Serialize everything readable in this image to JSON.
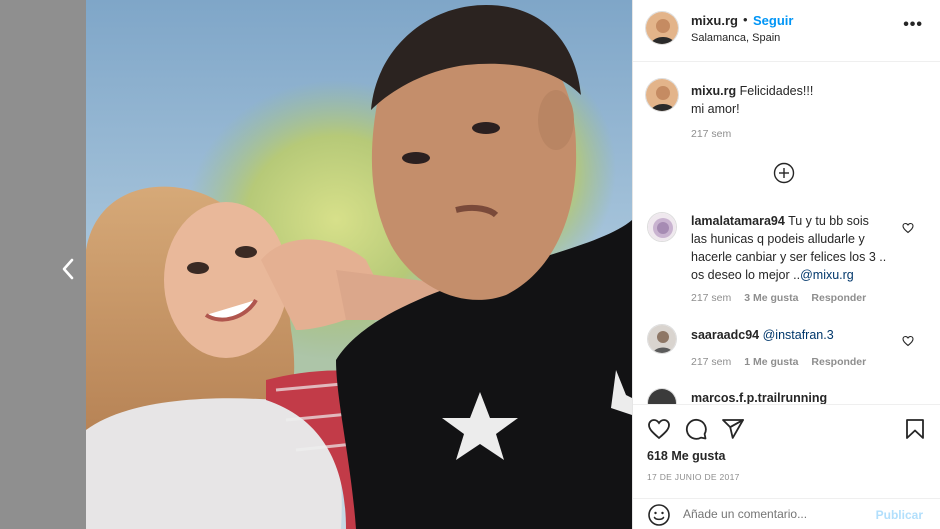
{
  "post": {
    "username": "mixu.rg",
    "separator": "•",
    "follow_label": "Seguir",
    "location": "Salamanca, Spain",
    "more_label": "•••"
  },
  "caption": {
    "username": "mixu.rg",
    "text_line1": "Felicidades!!!",
    "text_line2": "mi amor!",
    "time": "217 sem"
  },
  "comments": [
    {
      "username": "lamalatamara94",
      "line1": "Tu y tu bb sois",
      "line2": "las hunicas q podeis alludarle y",
      "line3": "hacerle canbiar y ser felices los 3 ..",
      "line4": "os deseo lo mejor ..",
      "mention": "@mixu.rg",
      "time": "217 sem",
      "likes": "3 Me gusta",
      "reply": "Responder"
    },
    {
      "username": "saaraadc94",
      "mention": "@instafran.3",
      "time": "217 sem",
      "likes": "1 Me gusta",
      "reply": "Responder"
    },
    {
      "username": "marcos.f.p.trailrunning"
    }
  ],
  "actions": {
    "likes_count": "618 Me gusta",
    "date": "17 DE JUNIO DE 2017"
  },
  "add_comment": {
    "placeholder": "Añade un comentario...",
    "publish_label": "Publicar"
  },
  "colors": {
    "accent": "#0095f6",
    "publish_disabled": "#b2dffc",
    "overlay": "#8f8f8f"
  }
}
